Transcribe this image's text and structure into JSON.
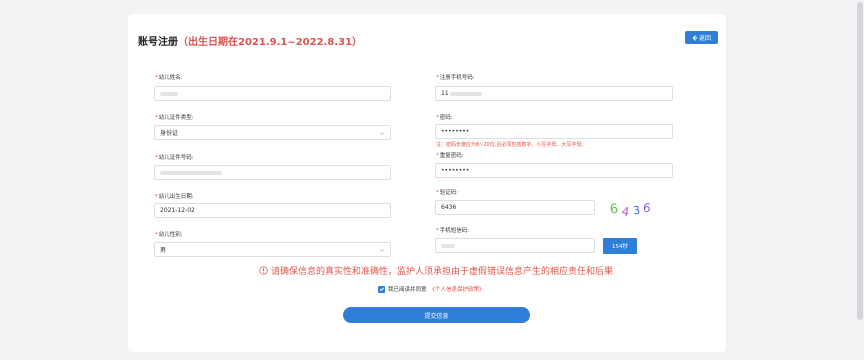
{
  "header": {
    "title": "账号注册",
    "subtitle": "（出生日期在2021.9.1~2022.8.31）",
    "back_label": "返回"
  },
  "form": {
    "left": [
      {
        "label": "幼儿姓名:",
        "value": ""
      },
      {
        "label": "幼儿证件类型:",
        "value": "身份证"
      },
      {
        "label": "幼儿证件号码:",
        "value": ""
      },
      {
        "label": "幼儿出生日期:",
        "value": "2021-12-02"
      },
      {
        "label": "幼儿性别:",
        "value": "男"
      }
    ],
    "right": [
      {
        "label": "注册手机号码:",
        "value": "11"
      },
      {
        "label": "密码:",
        "value": "••••••••"
      },
      {
        "label": "重复密码:",
        "value": "••••••••"
      },
      {
        "label": "验证码:",
        "value": "6436"
      },
      {
        "label": "手机短信码:",
        "value": ""
      }
    ],
    "password_hint": "注：密码长度应为8~20位,且必须包括数字、小写字母、大写字母。",
    "required_mark": "*",
    "captcha_text": "6436",
    "sms_button": "154秒"
  },
  "notice": "请确保信息的真实性和准确性，监护人须承担由于虚假错误信息产生的相应责任和后果",
  "agreement": {
    "prefix": "我已阅读并同意",
    "link": "《个人信息保护政策》"
  },
  "submit_label": "提交信息",
  "colors": {
    "accent": "#2f7fd8",
    "danger": "#e74c3c",
    "background": "#f2f3f5"
  },
  "icons": [
    "arrow-left-icon",
    "chevron-down-icon",
    "info-circle-icon",
    "checkbox-checked-icon"
  ]
}
